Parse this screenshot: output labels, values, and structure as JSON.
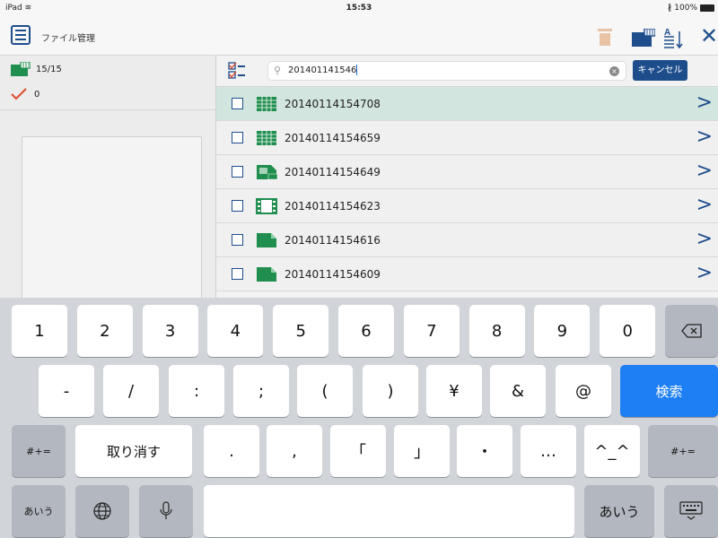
{
  "status_bar": {
    "device": "iPad",
    "time": "15:53",
    "battery": "100%"
  },
  "header": {
    "title": "ファイル管理"
  },
  "left_panel": {
    "file_count": "15/15",
    "checked_count": "0"
  },
  "search": {
    "query": "201401141546",
    "cancel_label": "キャンセル"
  },
  "files": [
    {
      "name": "20140114154708",
      "type": "spreadsheet",
      "selected": true
    },
    {
      "name": "20140114154659",
      "type": "spreadsheet",
      "selected": false
    },
    {
      "name": "20140114154649",
      "type": "jpg",
      "selected": false
    },
    {
      "name": "20140114154623",
      "type": "video",
      "selected": false
    },
    {
      "name": "20140114154616",
      "type": "document",
      "selected": false
    },
    {
      "name": "20140114154609",
      "type": "document",
      "selected": false
    }
  ],
  "keyboard": {
    "row1": [
      "1",
      "2",
      "3",
      "4",
      "5",
      "6",
      "7",
      "8",
      "9",
      "0"
    ],
    "row2": [
      "-",
      "/",
      ":",
      ";",
      "(",
      ")",
      "¥",
      "&",
      "@"
    ],
    "search_key": "検索",
    "symbols_key": "#+=",
    "undo_key": "取り消す",
    "row3": [
      ".",
      ",",
      "「",
      "」",
      "・",
      "…",
      "^_^"
    ],
    "kana_key": "あいう"
  },
  "colors": {
    "accent": "#1e4d8c",
    "green": "#1f8e4e",
    "selected_row": "#d3e5df",
    "search_key": "#1e7ff5"
  }
}
